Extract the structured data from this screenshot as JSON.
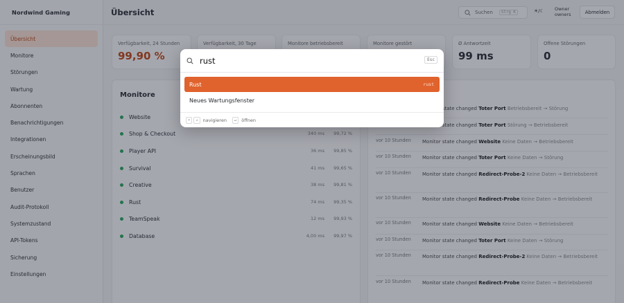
{
  "app": {
    "brand": "Nordwind Gaming"
  },
  "sidebar": {
    "items": [
      {
        "label": "Übersicht",
        "active": true
      },
      {
        "label": "Monitore"
      },
      {
        "label": "Störungen"
      },
      {
        "label": "Wartung"
      },
      {
        "label": "Abonnenten"
      },
      {
        "label": "Benachrichtigungen"
      },
      {
        "label": "Integrationen"
      },
      {
        "label": "Erscheinungsbild"
      },
      {
        "label": "Sprachen"
      },
      {
        "label": "Benutzer"
      },
      {
        "label": "Audit-Protokoll"
      },
      {
        "label": "Systemzustand"
      },
      {
        "label": "API-Tokens"
      },
      {
        "label": "Sicherung"
      },
      {
        "label": "Einstellungen"
      }
    ]
  },
  "header": {
    "title": "Übersicht",
    "search_label": "Suchen",
    "search_shortcut": "Strg K",
    "theme_label": "☀/☾",
    "user_line1": "Owner",
    "user_line2": "owners",
    "logout_label": "Abmelden"
  },
  "stats": [
    {
      "label": "Verfügbarkeit, 24 Stunden",
      "value": "99,90 %"
    },
    {
      "label": "Verfügbarkeit, 30 Tage",
      "value": ""
    },
    {
      "label": "Monitore betriebsbereit",
      "value": ""
    },
    {
      "label": "Monitore gestört",
      "value": ""
    },
    {
      "label": "Ø Antwortzeit",
      "value": "99 ms"
    },
    {
      "label": "Offene Störungen",
      "value": "0"
    }
  ],
  "monitors_panel": {
    "title": "Monitore",
    "rows": [
      {
        "name": "Website",
        "ms": "",
        "uptime": ""
      },
      {
        "name": "Shop & Checkout",
        "ms": "340 ms",
        "uptime": "99,72 %"
      },
      {
        "name": "Player API",
        "ms": "36 ms",
        "uptime": "99,85 %"
      },
      {
        "name": "Survival",
        "ms": "41 ms",
        "uptime": "99,65 %"
      },
      {
        "name": "Creative",
        "ms": "38 ms",
        "uptime": "99,81 %"
      },
      {
        "name": "Rust",
        "ms": "74 ms",
        "uptime": "99,35 %"
      },
      {
        "name": "TeamSpeak",
        "ms": "12 ms",
        "uptime": "99,93 %"
      },
      {
        "name": "Database",
        "ms": "4,00 ms",
        "uptime": "99,97 %"
      }
    ]
  },
  "events_panel": {
    "rows": [
      {
        "time": "",
        "prefix": "Monitor state changed",
        "monitor": "Toter Port",
        "detail": "Betriebsbereit → Störung"
      },
      {
        "time": "",
        "prefix": "Monitor state changed",
        "monitor": "Toter Port",
        "detail": "Störung → Betriebsbereit"
      },
      {
        "time": "vor 10 Stunden",
        "prefix": "Monitor state changed",
        "monitor": "Website",
        "detail": "Keine Daten → Betriebsbereit"
      },
      {
        "time": "vor 10 Stunden",
        "prefix": "Monitor state changed",
        "monitor": "Toter Port",
        "detail": "Keine Daten → Störung"
      },
      {
        "time": "vor 10 Stunden",
        "prefix": "Monitor state changed",
        "monitor": "Redirect-Probe-2",
        "detail": "Keine Daten → Betriebsbereit"
      },
      {
        "time": "vor 10 Stunden",
        "prefix": "Monitor state changed",
        "monitor": "Redirect-Probe",
        "detail": "Keine Daten → Betriebsbereit"
      },
      {
        "time": "vor 10 Stunden",
        "prefix": "Monitor state changed",
        "monitor": "Website",
        "detail": "Keine Daten → Betriebsbereit"
      },
      {
        "time": "vor 10 Stunden",
        "prefix": "Monitor state changed",
        "monitor": "Toter Port",
        "detail": "Keine Daten → Störung"
      },
      {
        "time": "vor 10 Stunden",
        "prefix": "Monitor state changed",
        "monitor": "Redirect-Probe-2",
        "detail": "Keine Daten → Betriebsbereit"
      },
      {
        "time": "vor 10 Stunden",
        "prefix": "Monitor state changed",
        "monitor": "Redirect-Probe",
        "detail": "Keine Daten → Betriebsbereit"
      }
    ]
  },
  "palette": {
    "query": "rust",
    "esc_label": "Esc",
    "results": [
      {
        "label": "Rust",
        "slug": "rust",
        "selected": true
      },
      {
        "label": "Neues Wartungsfenster",
        "slug": ""
      }
    ],
    "footer": {
      "nav_keys": [
        "↑",
        "↓"
      ],
      "nav_label": "navigieren",
      "open_key": "↵",
      "open_label": "öffnen"
    }
  },
  "colors": {
    "accent": "#e0622d",
    "status_up": "#22a55a"
  }
}
